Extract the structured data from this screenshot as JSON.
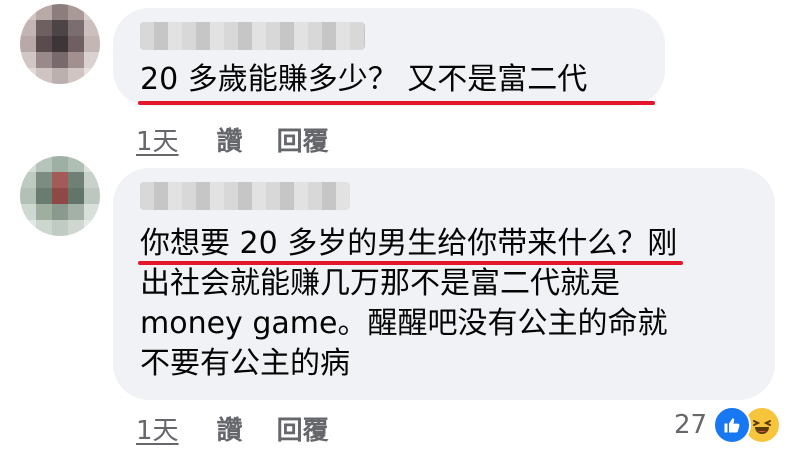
{
  "comments": [
    {
      "text": "20 多歲能賺多少？ 又不是富二代",
      "timestamp": "1天",
      "like_label": "讚",
      "reply_label": "回覆"
    },
    {
      "text": "你想要 20 多岁的男生给你带来什么？刚\n出社会就能赚几万那不是富二代就是\nmoney game。醒醒吧没有公主的命就\n不要有公主的病",
      "timestamp": "1天",
      "like_label": "讚",
      "reply_label": "回覆",
      "reaction_count": "27",
      "reactions": [
        "like-icon",
        "haha-icon"
      ]
    }
  ],
  "colors": {
    "bubble": "#f0f2f5",
    "highlight_underline": "#e3162c",
    "meta_text": "#65676b",
    "like_blue": "#1877f2",
    "haha_yellow": "#f7c53c"
  }
}
